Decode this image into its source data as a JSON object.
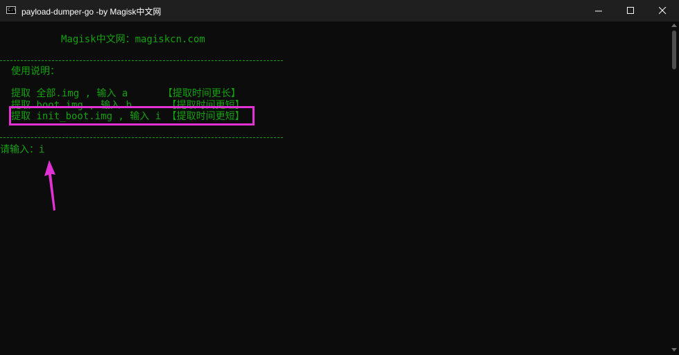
{
  "window": {
    "title": "payload-dumper-go -by Magisk中文网",
    "icon": "C:\\",
    "buttons": {
      "minimize": "minimize-icon",
      "maximize": "maximize-icon",
      "close": "close-icon"
    }
  },
  "terminal": {
    "header": "Magisk中文网：magiskcn.com",
    "separator": "----------------------------------------------------------",
    "usage_title": "使用说明：",
    "options": [
      {
        "text": "提取 全部.img , 输入 a      【提取时间更长】"
      },
      {
        "text": "提取 boot.img , 输入 b      【提取时间更短】"
      },
      {
        "text": "提取 init_boot.img , 输入 i 【提取时间更短】"
      }
    ],
    "prompt": "请输入：i"
  },
  "annotations": {
    "highlight_color": "#e431d6",
    "arrow_icon": "arrow-up-icon"
  },
  "colors": {
    "text": "#13a10e",
    "background": "#0c0c0c",
    "titlebar": "#1f1f1f"
  }
}
